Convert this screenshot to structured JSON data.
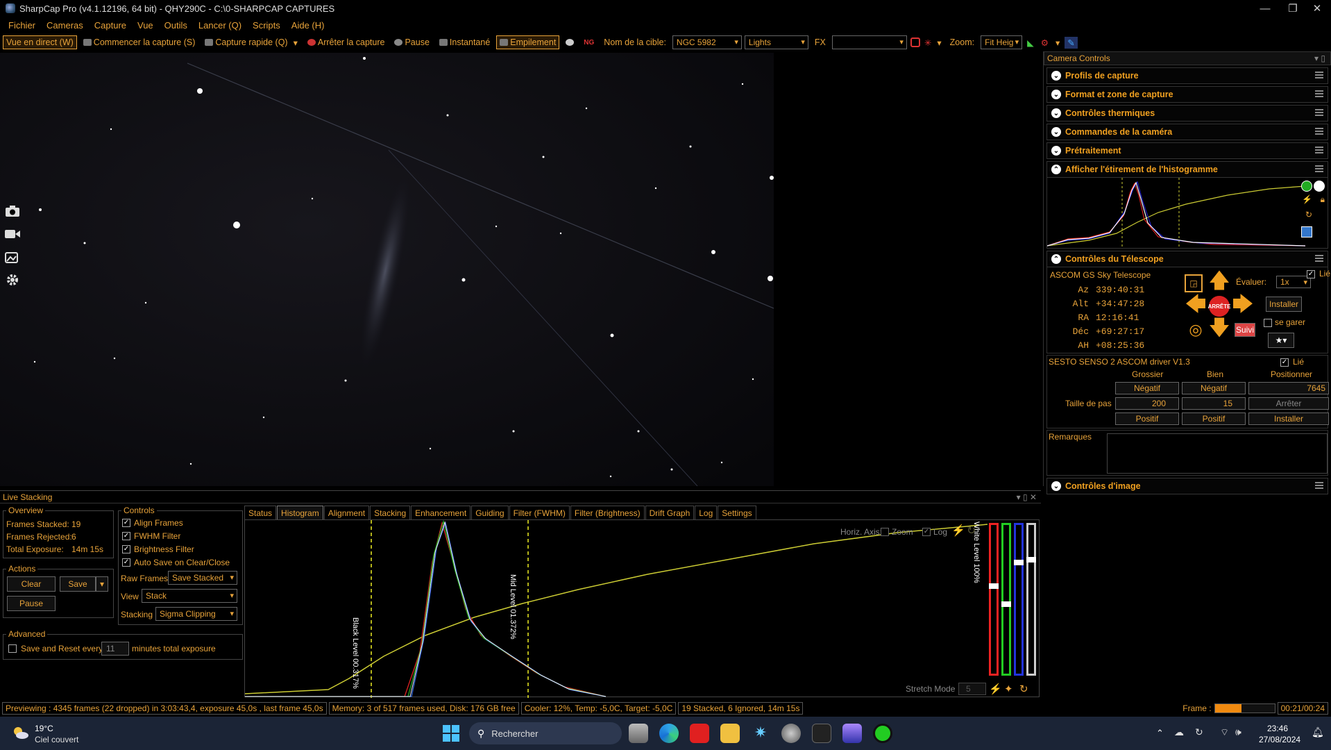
{
  "window": {
    "title": "SharpCap Pro (v4.1.12196, 64 bit) - QHY290C - C:\\0-SHARPCAP CAPTURES"
  },
  "menu": [
    "Fichier",
    "Cameras",
    "Capture",
    "Vue",
    "Outils",
    "Lancer (Q)",
    "Scripts",
    "Aide (H)"
  ],
  "toolbar": {
    "live": "Vue en direct (W)",
    "start": "Commencer la capture (S)",
    "quick": "Capture rapide (Q)",
    "stop": "Arrêter la capture",
    "pause": "Pause",
    "snapshot": "Instantané",
    "stacking": "Empilement",
    "target_label": "Nom de la cible:",
    "target_value": "NGC 5982",
    "frame_type": "Lights",
    "fx_label": "FX",
    "fx_value": "",
    "zoom_label": "Zoom:",
    "zoom_value": "Fit Heig"
  },
  "right_panel": {
    "title": "Camera Controls",
    "sections": [
      "Profils de capture",
      "Format et zone de capture",
      "Contrôles thermiques",
      "Commandes de la caméra",
      "Prétraitement"
    ],
    "histo_section": "Afficher l'étirement de l'histogramme",
    "telescope_section": "Contrôles du Télescope",
    "telescope": {
      "name": "ASCOM GS Sky Telescope",
      "linked": "Lié",
      "rows": [
        {
          "k": "Az",
          "v": "339:40:31"
        },
        {
          "k": "Alt",
          "v": "+34:47:28"
        },
        {
          "k": "RA",
          "v": "12:16:41"
        },
        {
          "k": "Déc",
          "v": "+69:27:17"
        },
        {
          "k": "AH",
          "v": "+08:25:36"
        }
      ],
      "rate_label": "Évaluer:",
      "rate_value": "1x",
      "install": "Installer",
      "park": "se garer",
      "stop": "ARRÊTE",
      "track": "Suivi"
    },
    "focuser": {
      "name": "SESTO SENSO 2 ASCOM driver V1.3",
      "linked": "Lié",
      "col1": "Grossier",
      "col2": "Bien",
      "col3": "Positionner",
      "neg1": "Négatif",
      "neg2": "Négatif",
      "pos_value": "7645",
      "step_label": "Taille de pas",
      "step1": "200",
      "step2": "15",
      "stop": "Arrêter",
      "pos1": "Positif",
      "pos2": "Positif",
      "install": "Installer"
    },
    "notes_label": "Remarques",
    "image_section": "Contrôles d'image"
  },
  "live_stacking": {
    "title": "Live Stacking",
    "overview": {
      "legend": "Overview",
      "stacked_label": "Frames Stacked:",
      "stacked": "19",
      "rejected_label": "Frames Rejected:",
      "rejected": "6",
      "exposure_label": "Total Exposure:",
      "exposure": "14m 15s"
    },
    "actions": {
      "legend": "Actions",
      "clear": "Clear",
      "save": "Save",
      "pause": "Pause"
    },
    "advanced": {
      "legend": "Advanced",
      "save_reset": "Save and Reset every",
      "minutes": "11",
      "minutes_suffix": "minutes total exposure"
    },
    "controls": {
      "legend": "Controls",
      "checks": [
        "Align Frames",
        "FWHM Filter",
        "Brightness Filter",
        "Auto Save on Clear/Close"
      ],
      "raw_label": "Raw Frames",
      "raw_value": "Save Stacked",
      "view_label": "View",
      "view_value": "Stack",
      "stacking_label": "Stacking",
      "stacking_value": "Sigma Clipping"
    },
    "tabs": [
      "Status",
      "Histogram",
      "Alignment",
      "Stacking",
      "Enhancement",
      "Guiding",
      "Filter (FWHM)",
      "Filter (Brightness)",
      "Drift Graph",
      "Log",
      "Settings"
    ],
    "histogram": {
      "horiz_axis": "Horiz. Axis:",
      "zoom": "Zoom",
      "log": "Log",
      "black_level": "Black Level 00.317%",
      "mid_level": "Mid Level 01.372%",
      "white_level": "White Level 100%",
      "stretch_mode": "Stretch Mode",
      "stretch_value": "5"
    }
  },
  "status": {
    "preview": "Previewing : 4345 frames (22 dropped) in 3:03:43,4, exposure 45,0s , last frame 45,0s",
    "memory": "Memory: 3 of 517 frames used, Disk: 176 GB free",
    "cooler": "Cooler: 12%, Temp: -5,0C, Target: -5,0C",
    "stacked": "19 Stacked, 6 Ignored, 14m 15s",
    "frame_label": "Frame :",
    "frame_time": "00:21/00:24",
    "frame_progress": 0.45
  },
  "taskbar": {
    "weather_temp": "19°C",
    "weather_desc": "Ciel couvert",
    "search": "Rechercher",
    "time": "23:46",
    "date": "27/08/2024"
  }
}
